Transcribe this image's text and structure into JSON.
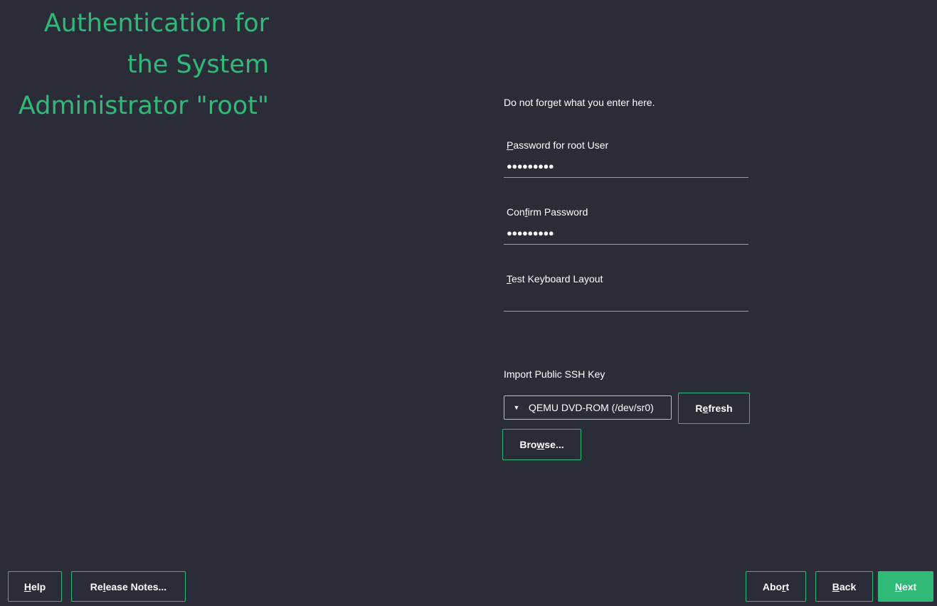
{
  "page": {
    "title_lines": [
      "Authentication for",
      "the System",
      "Administrator \"root\""
    ]
  },
  "form": {
    "intro": "Do not forget what you enter here.",
    "password": {
      "label": "Password for root User",
      "value": "●●●●●●●●●"
    },
    "confirm": {
      "label": "Confirm Password",
      "value": "●●●●●●●●●"
    },
    "keyboard": {
      "label": "Test Keyboard Layout",
      "value": ""
    },
    "ssh": {
      "label": "Import Public SSH Key",
      "selected_device": "QEMU DVD-ROM (/dev/sr0)",
      "refresh_label": "Refresh",
      "browse_label": "Browse..."
    }
  },
  "footer": {
    "help_label": "Help",
    "release_notes_label": "Release Notes...",
    "abort_label": "Abort",
    "back_label": "Back",
    "next_label": "Next"
  },
  "colors": {
    "background": "#2a2d38",
    "accent": "#30ba78",
    "text": "#ffffff"
  },
  "icons": {
    "combo_arrow": "caret-down-icon"
  }
}
